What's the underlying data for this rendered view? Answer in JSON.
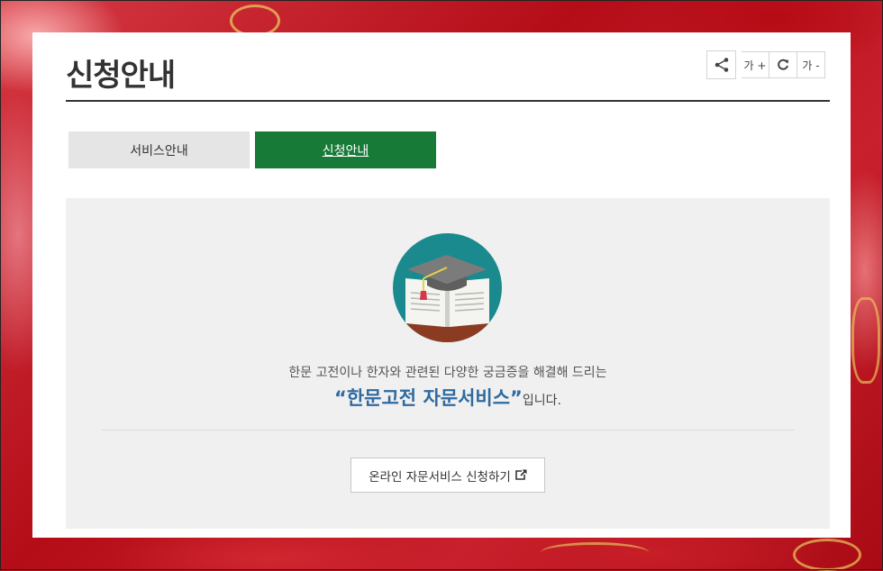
{
  "page": {
    "title": "신청안내"
  },
  "toolbar": {
    "share_icon": "share-icon",
    "font_increase_label": "가 +",
    "reset_icon": "refresh-icon",
    "font_decrease_label": "가 -"
  },
  "tabs": [
    {
      "label": "서비스안내",
      "active": false
    },
    {
      "label": "신청안내",
      "active": true
    }
  ],
  "content": {
    "lead_text": "한문 고전이나 한자와 관련된 다양한 궁금증을 해결해 드리는",
    "headline_strong": "“한문고전 자문서비스”",
    "headline_suffix": "입니다.",
    "illustration": "graduation-cap-book-icon",
    "cta_label": "온라인 자문서비스 신청하기",
    "cta_icon": "external-link-icon"
  },
  "colors": {
    "accent_green": "#177a37",
    "headline_blue": "#2f6aa0",
    "icon_teal": "#1a8a8f"
  }
}
